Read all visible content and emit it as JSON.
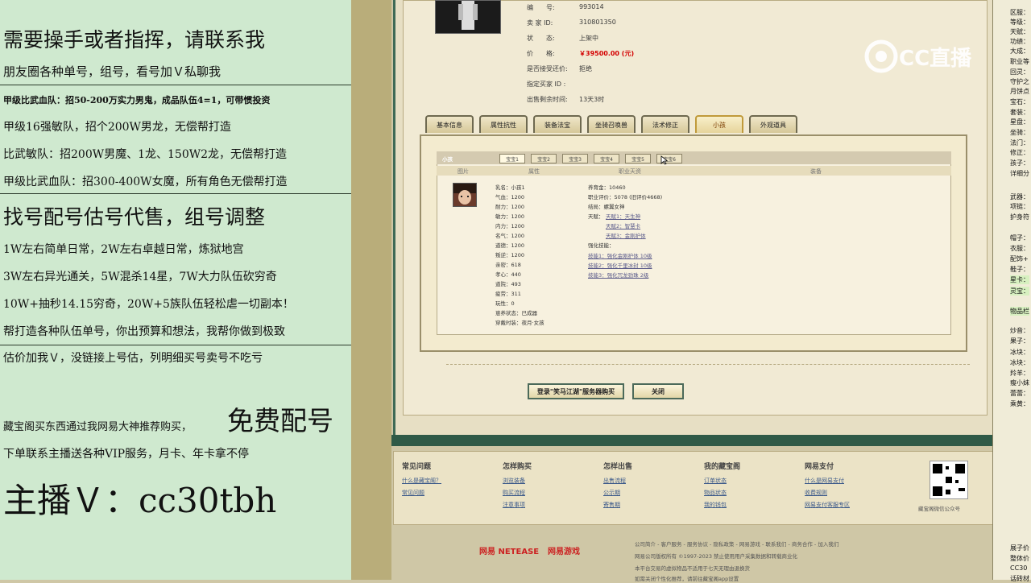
{
  "overlay": {
    "lines": [
      "需要操手或者指挥，请联系我",
      "朋友圈各种单号，组号，看号加Ｖ私聊我",
      "甲级比武血队：招50-200万实力男鬼，成品队伍4=1，可带惯投资",
      "甲级16强敏队，招个200W男龙，无偿帮打造",
      "比武敏队：招200W男魔、1龙、150W2龙，无偿帮打造",
      "甲级比武血队：招300-400W女魔，所有角色无偿帮打造",
      "找号配号估号代售，组号调整",
      "1W左右简单日常，2W左右卓越日常，炼狱地宫",
      "3W左右异光通关，5W混杀14星，7W大力队伍砍穷奇",
      "10W+抽秒14.15穷奇，20W+5族队伍轻松虐一切副本！",
      "帮打造各种队伍单号，你出预算和想法，我帮你做到极致",
      "估价加我Ｖ，没链接上号估，列明细买号卖号不吃亏",
      "藏宝阁买东西通过我网易大神推荐购买，",
      "免费配号",
      "下单联系主播送各种VIP服务，月卡、年卡拿不停",
      "主播Ｖ：cc30tbh"
    ]
  },
  "watermark": "CC直播",
  "item": {
    "fields": [
      {
        "label": "编　　号:",
        "value": "993014"
      },
      {
        "label": "卖 家 ID:",
        "value": "310801350"
      },
      {
        "label": "状　　态:",
        "value": "上架中"
      },
      {
        "label": "价　　格:",
        "value": "￥39500.00 (元)"
      },
      {
        "label": "是否接受还价:",
        "value": "拒绝"
      },
      {
        "label": "指定买家 ID :",
        "value": ""
      },
      {
        "label": "出售剩余时间:",
        "value": "13天3时"
      }
    ]
  },
  "tabs": [
    "基本信息",
    "属性抗性",
    "装备法宝",
    "坐骑召唤兽",
    "法术修正",
    "小孩",
    "外观道具"
  ],
  "child": {
    "section_label": "小孩",
    "subtabs": [
      "宝宝1",
      "宝宝2",
      "宝宝3",
      "宝宝4",
      "宝宝5",
      "宝宝6"
    ],
    "col_headers": [
      "图片",
      "属性",
      "职业天资",
      "装备"
    ],
    "stats": [
      "乳名：小孩1",
      "气血：1200",
      "耐力：1200",
      "敏力：1200",
      "内力：1200",
      "名气：1200",
      "道德：1200",
      "叛逆：1200",
      "亲密：618",
      "孝心：440",
      "道院：493",
      "疲劳：311",
      "玩性：0",
      "崽养状态：已成器",
      "穿戴时装：夜月·女孩"
    ],
    "career": [
      "养育金：10460",
      "职业评价：5078 (旧评价4668)",
      "结局：螺翼女神",
      "天赋：",
      "天赋1：天生神",
      "天赋2：智慧卡",
      "天赋3：金刚护体",
      "强化技能：",
      "技能1：强化金刚护体 10级",
      "技能2：强化千里冰封 10级",
      "技能3：强化冗龙劲珠 2级"
    ]
  },
  "buttons": {
    "login": "登录\"笑马江湖\"服务器购买",
    "close": "关闭"
  },
  "footer": {
    "cols": [
      {
        "title": "常见问题",
        "links": [
          "什么是藏宝阁？",
          "常见问题"
        ]
      },
      {
        "title": "怎样购买",
        "links": [
          "浏览装备",
          "购买流程",
          "注意事项"
        ]
      },
      {
        "title": "怎样出售",
        "links": [
          "出售流程",
          "公示期",
          "寄售期"
        ]
      },
      {
        "title": "我的藏宝阁",
        "links": [
          "订单状态",
          "物品状态",
          "我的钱包"
        ]
      },
      {
        "title": "网易支付",
        "links": [
          "什么是网易支付",
          "收费规则",
          "网易支付客服专区"
        ]
      }
    ],
    "qr_caption": "藏宝阁微信公众号",
    "brand1": "网易 NETEASE",
    "brand2": "网易游戏",
    "legal": [
      "公司简介 - 客户服务 - 服务协议 - 隐私政策 - 网易游戏 - 联系我们 - 商务合作 - 加入我们",
      "网易公司版权所有 ©1997-2023 禁止使用用户采集数据和转载商业化",
      "本平台交易的虚拟物品不适用于七天无理由退换货",
      "如需关闭个性化推荐，请前往藏宝阁app设置"
    ]
  },
  "sidebar": {
    "keys": [
      "区服：",
      "等级：",
      "天赋：",
      "功绩：",
      "大成：",
      "职业等",
      "回灵：",
      "守护之",
      "月饼点",
      "宝石：",
      "套装：",
      "星盘：",
      "坐骑：",
      "法门：",
      "修正：",
      "孩子：",
      "详细分",
      "武器：",
      "项链：",
      "护身符",
      "帽子：",
      "衣服：",
      "配饰+",
      "鞋子：",
      "星卡：",
      "灵宝：",
      "物品栏",
      "炒音：",
      "果子：",
      "冰块：",
      "冰块：",
      "羚羊：",
      "瘦小妹",
      "蕾蕾：",
      "乘黄：",
      "展子价",
      "整体价",
      "CC30",
      "话砖材"
    ]
  }
}
